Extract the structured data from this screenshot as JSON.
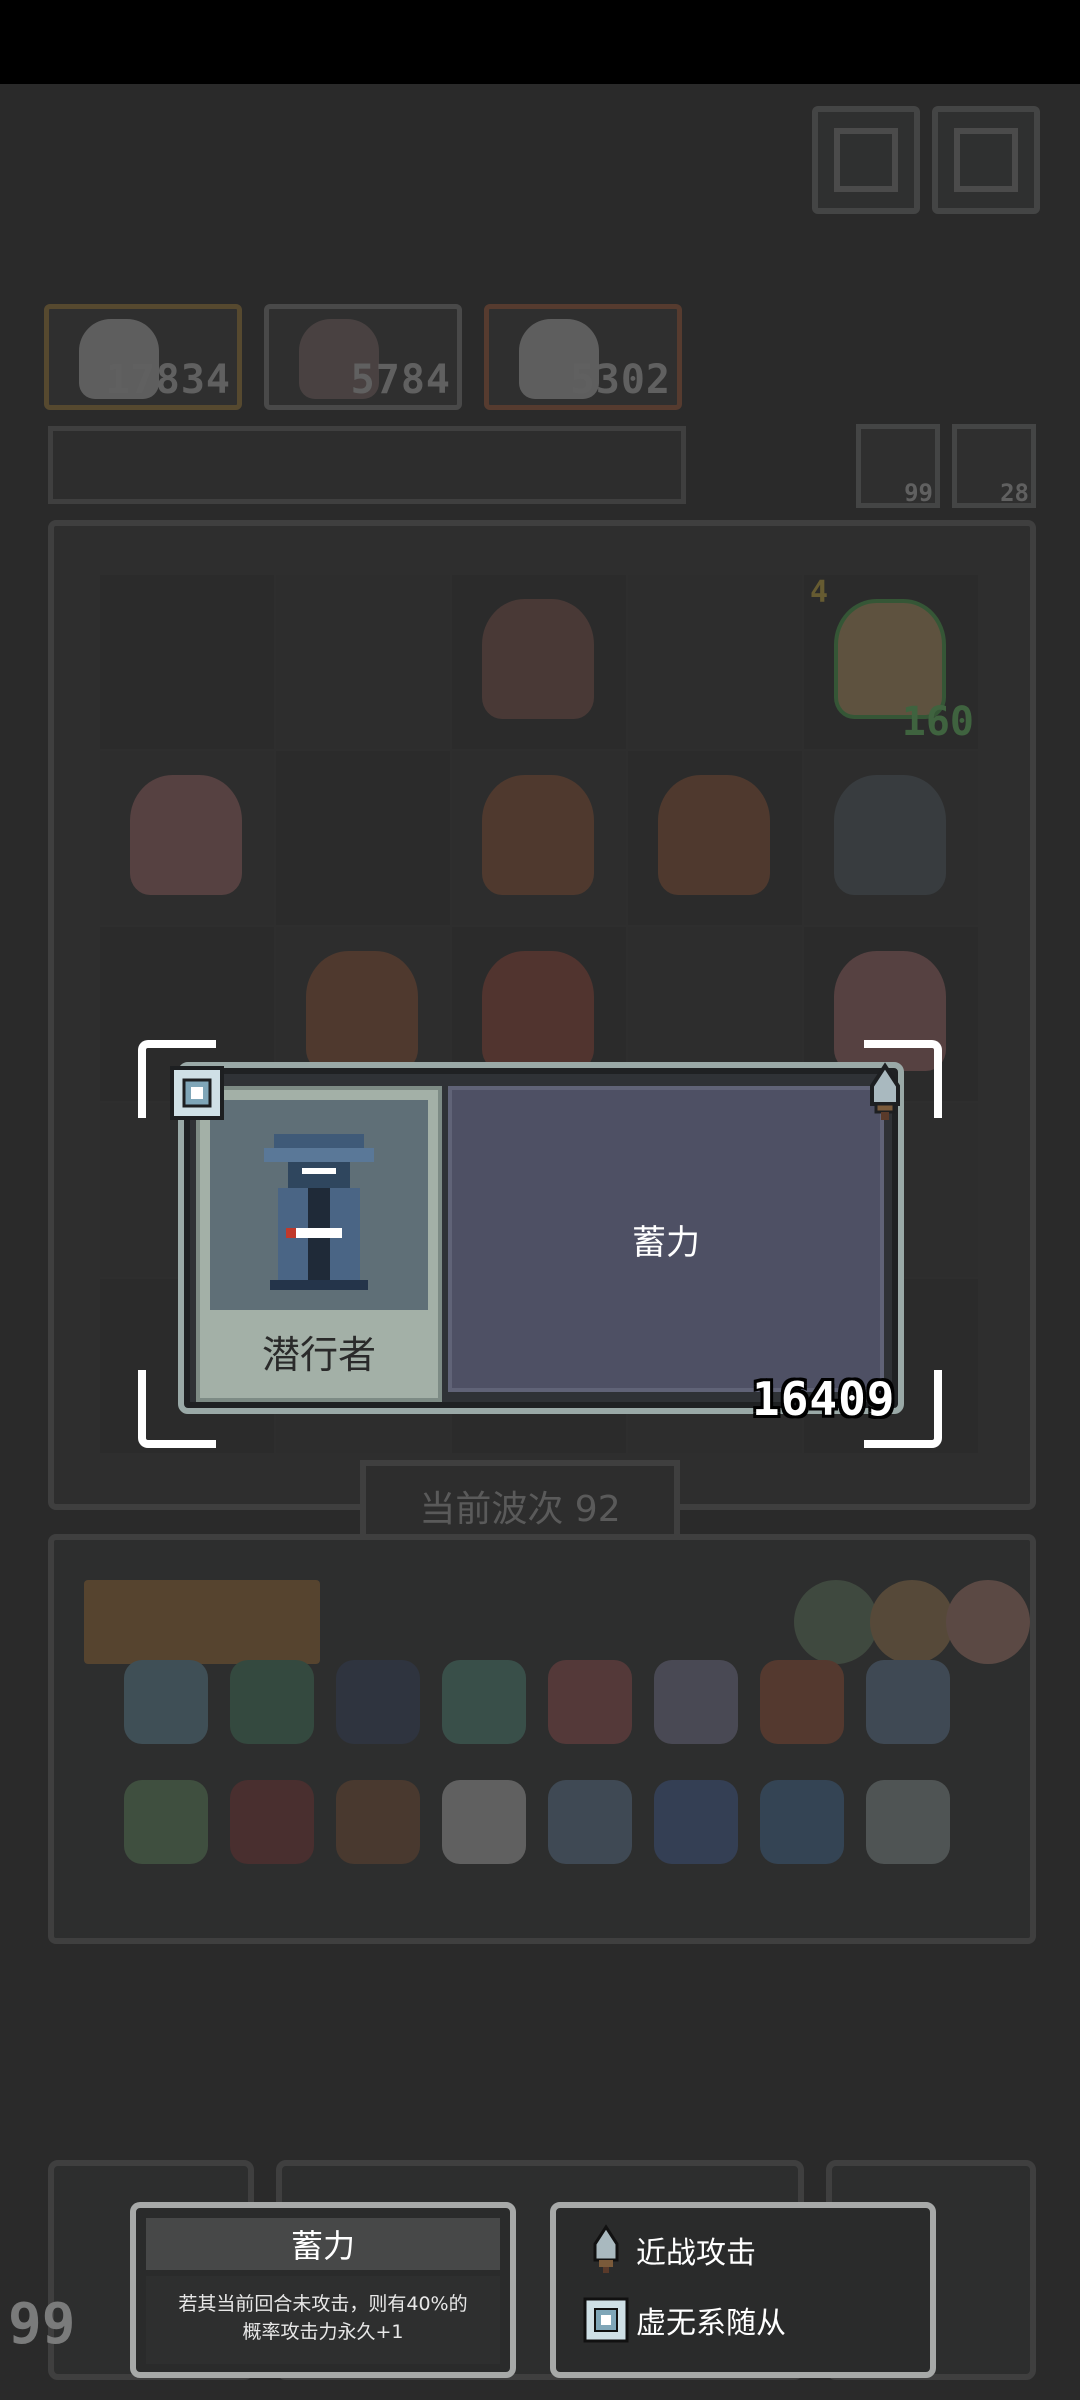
{
  "game": {
    "enemy_counters": [
      "17834",
      "5784",
      "5302"
    ],
    "resource_counts": [
      "99",
      "28"
    ],
    "board_power_badge": "4",
    "board_unit_power": "160",
    "wave_text": "当前波次 92",
    "corner_count": "99"
  },
  "selected_unit": {
    "name": "潜行者",
    "description_title": "蓄力",
    "power": "16409"
  },
  "tooltip_skill": {
    "title": "蓄力",
    "text_line1": "若其当前回合未攻击，则有40%的",
    "text_line2": "概率攻击力永久+1"
  },
  "tooltip_traits": {
    "trait1": "近战攻击",
    "trait2": "虚无系随从"
  },
  "colors": {
    "overlay_frame": "#9aa9a7",
    "description_bg": "#4e5064",
    "portrait_bg": "#5f6f77"
  },
  "icons": {
    "melee": "dagger-icon",
    "void": "void-crystal-icon"
  }
}
